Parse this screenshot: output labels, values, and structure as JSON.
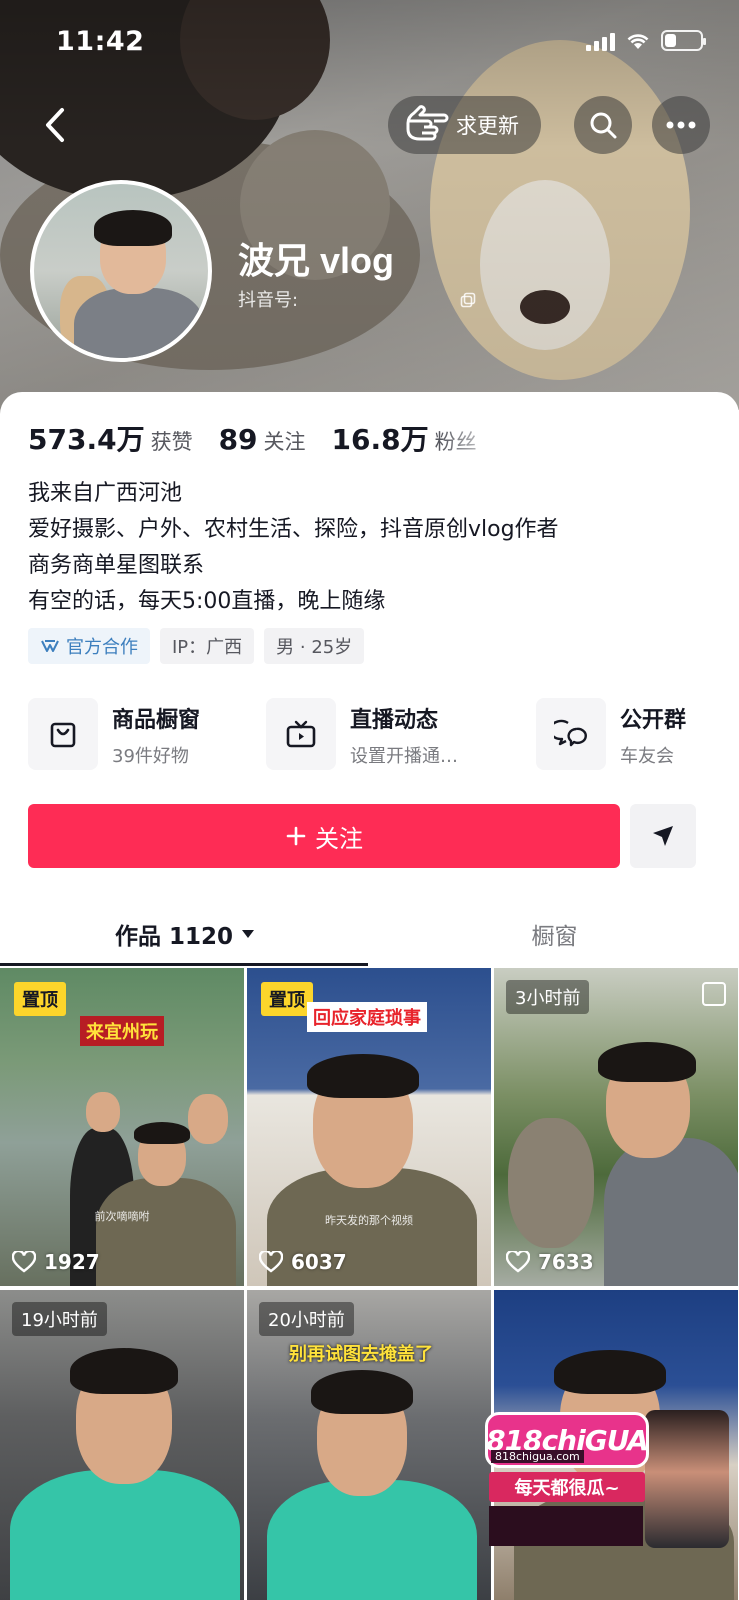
{
  "status": {
    "time": "11:42"
  },
  "nav": {
    "request_update_label": "求更新"
  },
  "profile": {
    "nickname": "波兄 vlog",
    "douyin_id_label": "抖音号:"
  },
  "stats": [
    {
      "value": "573.4万",
      "label": "获赞"
    },
    {
      "value": "89",
      "label": "关注"
    },
    {
      "value": "16.8万",
      "label": "粉丝"
    }
  ],
  "bio": [
    "我来自广西河池",
    " 爱好摄影、户外、农村生活、探险，抖音原创vlog作者",
    " 商务商单星图联系",
    "有空的话，每天5:00直播，晚上随缘"
  ],
  "tags": {
    "official": "官方合作",
    "ip": "IP：广西",
    "gender_age": "男 · 25岁"
  },
  "shortcuts": [
    {
      "title": "商品橱窗",
      "sub": "39件好物",
      "icon": "shopping-bag-icon"
    },
    {
      "title": "直播动态",
      "sub": "设置开播通…",
      "icon": "tv-icon"
    },
    {
      "title": "公开群",
      "sub": "车友会",
      "icon": "chat-bubbles-icon"
    }
  ],
  "actions": {
    "follow_label": "关注"
  },
  "tabs": {
    "works_label": "作品 1120",
    "shop_label": "橱窗"
  },
  "videos": [
    {
      "badge": "置顶",
      "caption": "来宜州玩",
      "likes": "1927",
      "subtitle": "前次嘀嘀咐"
    },
    {
      "badge": "置顶",
      "caption": "回应家庭琐事",
      "likes": "6037",
      "subtitle": "昨天发的那个视频"
    },
    {
      "badge": "3小时前",
      "likes": "7633"
    },
    {
      "badge": "19小时前"
    },
    {
      "badge": "20小时前",
      "caption": "别再试图去掩盖了"
    },
    {}
  ],
  "watermark": {
    "logo": "818chiGUA",
    "url": "818chigua.com",
    "slogan": "每天都很瓜~"
  },
  "colors": {
    "accent": "#fe2c55",
    "pin_badge": "#fcd52b",
    "official_tag": "#3d7fbe"
  }
}
